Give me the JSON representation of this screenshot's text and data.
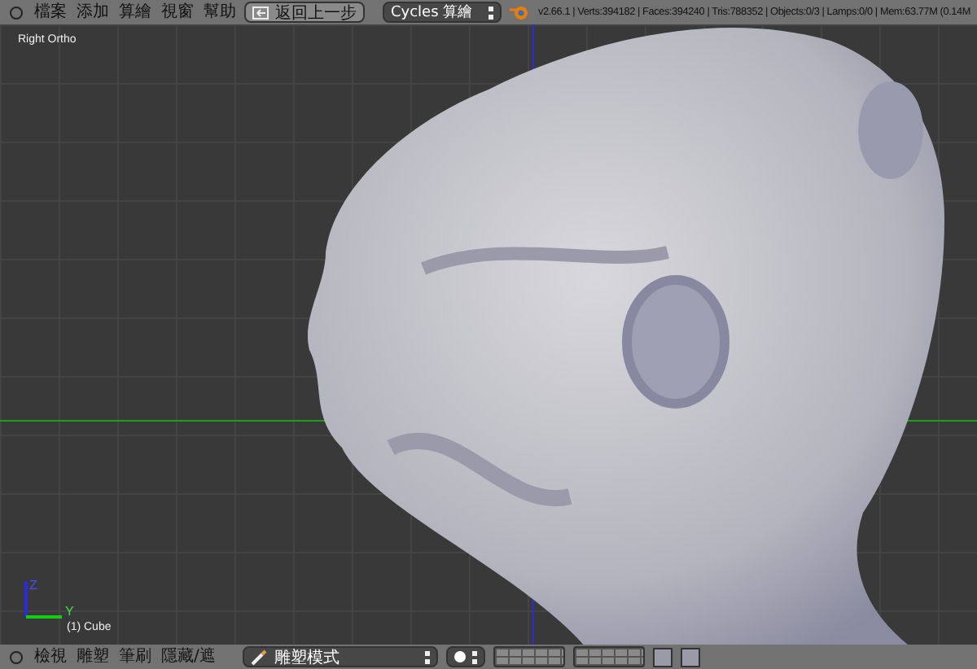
{
  "top_bar": {
    "menus": [
      "檔案",
      "添加",
      "算繪",
      "視窗",
      "幫助"
    ],
    "undo_button": "返回上一步",
    "render_engine": "Cycles 算繪",
    "stats": "v2.66.1 | Verts:394182 | Faces:394240 | Tris:788352 | Objects:0/3 | Lamps:0/0 | Mem:63.77M (0.14M"
  },
  "viewport": {
    "view_label": "Right Ortho",
    "object_label": "(1) Cube",
    "axis_labels": [
      "Z",
      "Y"
    ]
  },
  "bottom_bar": {
    "menus": [
      "檢視",
      "雕塑",
      "筆刷",
      "隱藏/遮"
    ],
    "mode": "雕塑模式"
  }
}
